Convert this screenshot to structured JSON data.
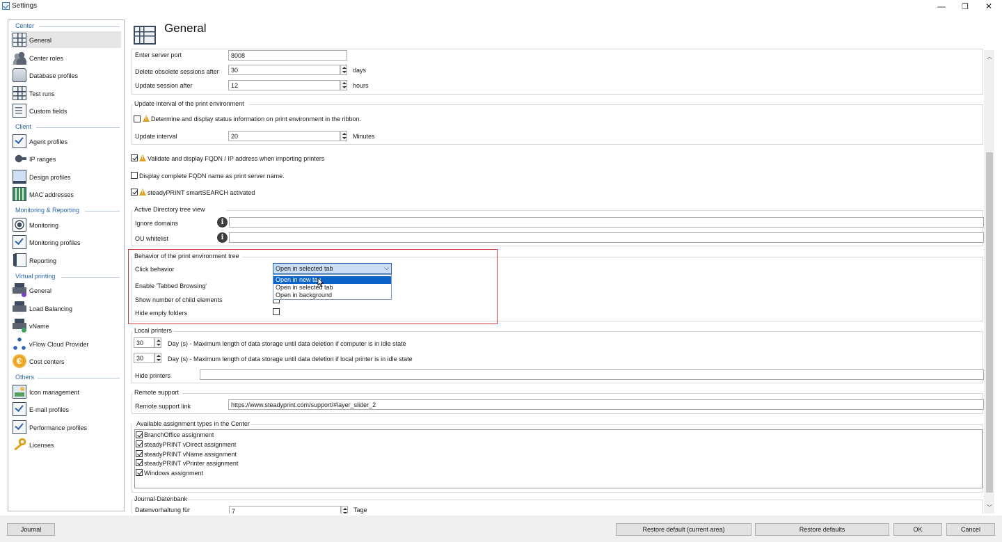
{
  "window": {
    "title": "Settings",
    "min": "—",
    "restore": "❐",
    "close": "✕"
  },
  "sidebar": {
    "sections": {
      "center": "Center",
      "client": "Client",
      "monitoring": "Monitoring & Reporting",
      "virtual": "Virtual printing",
      "others": "Others"
    },
    "items": {
      "general": "General",
      "center_roles": "Center roles",
      "database_profiles": "Database profiles",
      "test_runs": "Test runs",
      "custom_fields": "Custom fields",
      "agent_profiles": "Agent profiles",
      "ip_ranges": "IP ranges",
      "design_profiles": "Design profiles",
      "mac_addresses": "MAC addresses",
      "monitoring": "Monitoring",
      "monitoring_profiles": "Monitoring profiles",
      "reporting": "Reporting",
      "vp_general": "General",
      "load_balancing": "Load Balancing",
      "vname": "vName",
      "vflow": "vFlow Cloud Provider",
      "cost_centers": "Cost centers",
      "icon_management": "Icon management",
      "email_profiles": "E-mail profiles",
      "performance_profiles": "Performance profiles",
      "licenses": "Licenses"
    }
  },
  "main": {
    "title": "General",
    "server": {
      "port_label": "Enter server port",
      "port_value": "8008",
      "delete_label": "Delete obsolete sessions after",
      "delete_value": "30",
      "delete_unit": "days",
      "update_label": "Update session after",
      "update_value": "12",
      "update_unit": "hours"
    },
    "update_interval": {
      "title": "Update interval of the print environment",
      "status_label": "Determine and display status information on print environment in the ribbon.",
      "interval_label": "Update interval",
      "interval_value": "20",
      "interval_unit": "Minutes"
    },
    "options": {
      "validate_fqdn": "Validate and display FQDN / IP address when importing printers",
      "display_fqdn": "Display complete FQDN name as print server name.",
      "smartsearch": "steadyPRINT smartSEARCH activated"
    },
    "ad_tree": {
      "title": "Active Directory tree view",
      "ignore_label": "Ignore domains",
      "ignore_value": "",
      "ou_label": "OU whitelist",
      "ou_value": "",
      "info_glyph": "i"
    },
    "behavior": {
      "title": "Behavior of the print environment tree",
      "click_label": "Click behavior",
      "click_value": "Open in selected tab",
      "options": [
        "Open in new tab",
        "Open in selected tab",
        "Open in background"
      ],
      "tabbed_label": "Enable 'Tabbed Browsing'",
      "child_label": "Show number of child elements",
      "empty_label": "Hide empty folders"
    },
    "local_printers": {
      "title": "Local printers",
      "idle_computer_value": "30",
      "idle_computer_label": "Day (s) - Maximum length of data storage until data deletion if computer is in idle state",
      "idle_printer_value": "30",
      "idle_printer_label": "Day (s) - Maximum length of data storage until data deletion if local printer is in idle state",
      "hide_label": "Hide printers",
      "hide_value": ""
    },
    "remote_support": {
      "title": "Remote support",
      "link_label": "Remote support link",
      "link_value": "https://www.steadyprint.com/support/#layer_slider_2"
    },
    "assignments": {
      "title": "Available assignment types in the Center",
      "items": [
        "BranchOffice assignment",
        "steadyPRINT vDirect assignment",
        "steadyPRINT vName assignment",
        "steadyPRINT vPrinter assignment",
        "Windows assignment"
      ]
    },
    "journal_db": {
      "title": "Journal-Datenbank",
      "retention_label": "Datenvorhaltung für",
      "retention_value": "7",
      "retention_unit": "Tage"
    }
  },
  "footer": {
    "journal": "Journal",
    "restore_area": "Restore default (current area)",
    "restore_all": "Restore defaults",
    "ok": "OK",
    "cancel": "Cancel"
  },
  "colors": {
    "accent": "#2a63b5",
    "highlight_border": "#d23a3a",
    "dropdown_selected": "#0a64c8"
  }
}
